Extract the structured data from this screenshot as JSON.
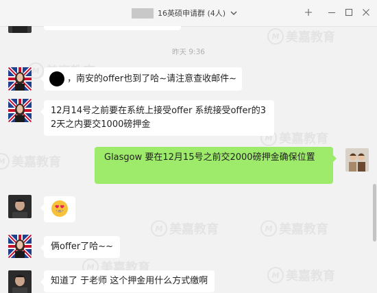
{
  "window": {
    "title": "16英硕申请群 (4人)"
  },
  "watermark": {
    "text": "美嘉教育"
  },
  "timestamp": "昨天 9:36",
  "messages": [
    {
      "side": "left",
      "avatar": "flag-avatar",
      "prefix_icon": "black-dot",
      "text": "，南安的offer也到了哈~请注意查收邮件~"
    },
    {
      "side": "left",
      "avatar": "flag-avatar",
      "lines": [
        "12月14号之前要在系统上接受offer  系统接受offer的3",
        "2天之内要交1000磅押金"
      ]
    },
    {
      "side": "right",
      "avatar": "photo-avatar",
      "text": "Glasgow 要在12月15号之前交2000磅押金确保位置"
    },
    {
      "side": "left",
      "avatar": "man-avatar",
      "emoji": "heart-eyes"
    },
    {
      "side": "left",
      "avatar": "flag-avatar",
      "text": "俩offer了哈~~"
    },
    {
      "side": "left",
      "avatar": "man-avatar",
      "text": "知道了 于老师 这个押金用什么方式缴啊"
    }
  ],
  "colors": {
    "background": "#f2f2f2",
    "incoming_bubble": "#ffffff",
    "outgoing_bubble": "#9eea6a"
  }
}
